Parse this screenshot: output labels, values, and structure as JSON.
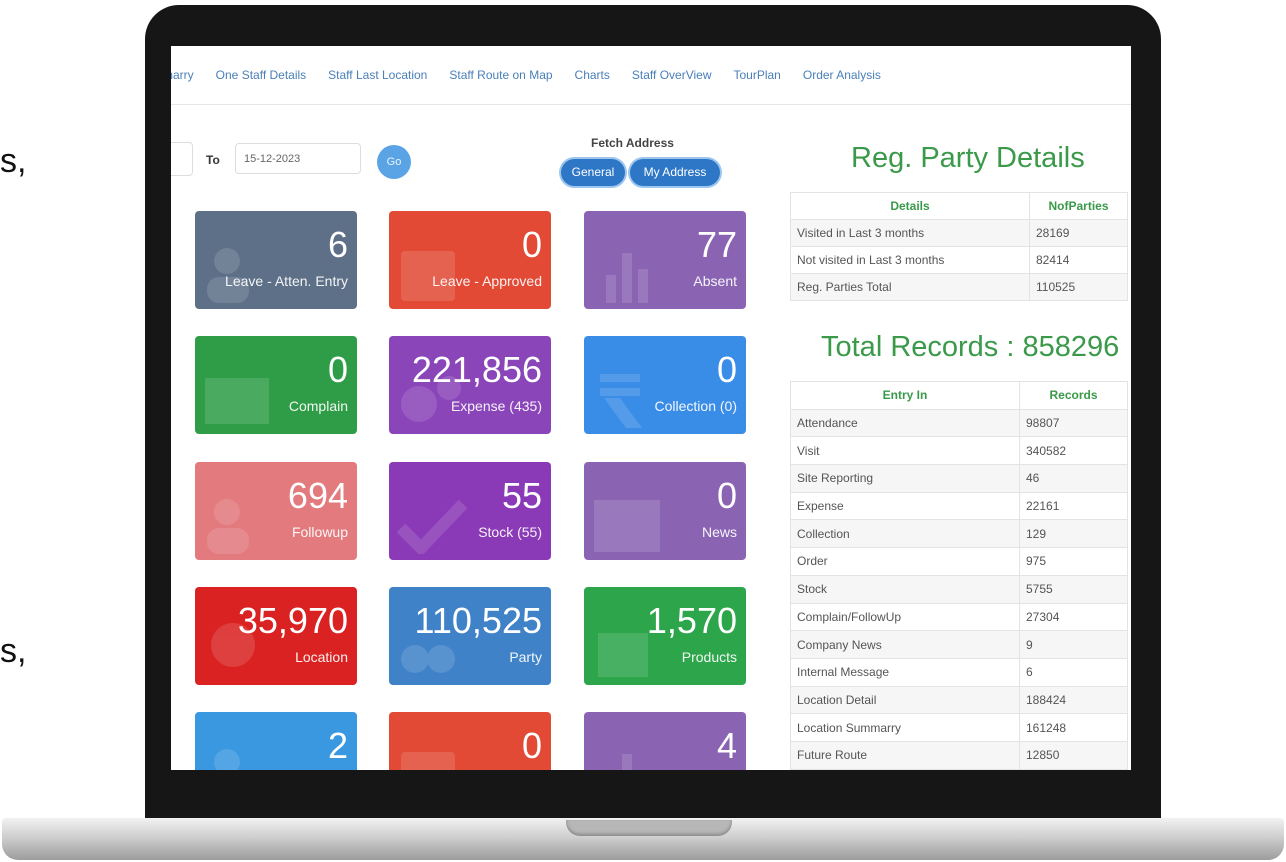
{
  "side_text": {
    "top": "s,",
    "bottom": "s,"
  },
  "nav": {
    "items": [
      "marry",
      "One Staff Details",
      "Staff Last Location",
      "Staff Route on Map",
      "Charts",
      "Staff OverView",
      "TourPlan",
      "Order Analysis"
    ]
  },
  "filter": {
    "to_label": "To",
    "to_date": "15-12-2023",
    "go_label": "Go"
  },
  "fetch_address": {
    "title": "Fetch Address",
    "general_label": "General",
    "my_address_label": "My Address"
  },
  "tiles": [
    {
      "value": "6",
      "label": "Leave - Atten. Entry",
      "color": "#5d7088",
      "icon": "user-icon"
    },
    {
      "value": "0",
      "label": "Leave - Approved",
      "color": "#e24a36",
      "icon": "calendar-icon"
    },
    {
      "value": "77",
      "label": "Absent",
      "color": "#8a64b3",
      "icon": "bar-chart-icon"
    },
    {
      "value": "0",
      "label": "Complain",
      "color": "#2f9d48",
      "icon": "envelope-icon"
    },
    {
      "value": "221,856",
      "label": "Expense (435)",
      "color": "#8a45b8",
      "icon": "cogs-icon"
    },
    {
      "value": "0",
      "label": "Collection (0)",
      "color": "#3a8de6",
      "icon": "rupee-icon"
    },
    {
      "value": "694",
      "label": "Followup",
      "color": "#e27a7e",
      "icon": "user-icon"
    },
    {
      "value": "55",
      "label": "Stock (55)",
      "color": "#8a3ab6",
      "icon": "check-icon"
    },
    {
      "value": "0",
      "label": "News",
      "color": "#8a64b3",
      "icon": "newspaper-icon"
    },
    {
      "value": "35,970",
      "label": "Location",
      "color": "#da2222",
      "icon": "map-pin-icon"
    },
    {
      "value": "110,525",
      "label": "Party",
      "color": "#3f82c8",
      "icon": "users-icon"
    },
    {
      "value": "1,570",
      "label": "Products",
      "color": "#2da54a",
      "icon": "box-icon"
    },
    {
      "value": "2",
      "label": "",
      "color": "#3a98e0",
      "icon": "user-icon"
    },
    {
      "value": "0",
      "label": "",
      "color": "#e24a36",
      "icon": "calendar-icon"
    },
    {
      "value": "4",
      "label": "",
      "color": "#8a64b3",
      "icon": "bar-chart-icon"
    }
  ],
  "reg_party": {
    "title": "Reg. Party Details",
    "headers": [
      "Details",
      "NofParties"
    ],
    "rows": [
      [
        "Visited in Last 3 months",
        "28169"
      ],
      [
        "Not visited in Last 3 months",
        "82414"
      ],
      [
        "Reg. Parties Total",
        "110525"
      ]
    ]
  },
  "total_records": {
    "title": "Total Records : 858296",
    "headers": [
      "Entry In",
      "Records"
    ],
    "rows": [
      [
        "Attendance",
        "98807"
      ],
      [
        "Visit",
        "340582"
      ],
      [
        "Site Reporting",
        "46"
      ],
      [
        "Expense",
        "22161"
      ],
      [
        "Collection",
        "129"
      ],
      [
        "Order",
        "975"
      ],
      [
        "Stock",
        "5755"
      ],
      [
        "Complain/FollowUp",
        "27304"
      ],
      [
        "Company News",
        "9"
      ],
      [
        "Internal Message",
        "6"
      ],
      [
        "Location Detail",
        "188424"
      ],
      [
        "Location Summarry",
        "161248"
      ],
      [
        "Future Route",
        "12850"
      ]
    ]
  }
}
